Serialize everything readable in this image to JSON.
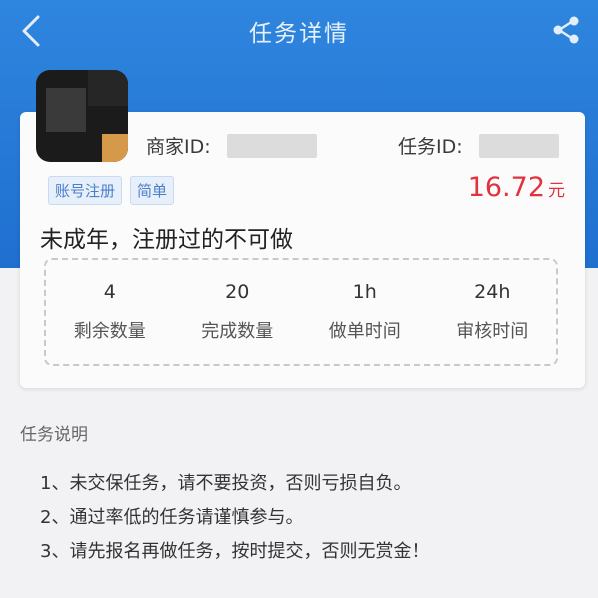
{
  "header": {
    "title": "任务详情",
    "back_icon": "back-chevron-icon",
    "share_icon": "share-icon",
    "bg_color": "#2a80d9"
  },
  "card": {
    "merchant_id_label": "商家ID:",
    "task_id_label": "任务ID:",
    "tags": [
      "账号注册",
      "简单"
    ],
    "price_amount": "16.72",
    "price_unit": "元",
    "price_color": "#e2323e",
    "title": "未成年，注册过的不可做",
    "stats": [
      {
        "value": "4",
        "label": "剩余数量"
      },
      {
        "value": "20",
        "label": "完成数量"
      },
      {
        "value": "1h",
        "label": "做单时间"
      },
      {
        "value": "24h",
        "label": "审核时间"
      }
    ]
  },
  "description": {
    "title": "任务说明",
    "items": [
      "1、未交保任务，请不要投资，否则亏损自负。",
      "2、通过率低的任务请谨慎参与。",
      "3、请先报名再做任务，按时提交，否则无赏金！"
    ]
  }
}
